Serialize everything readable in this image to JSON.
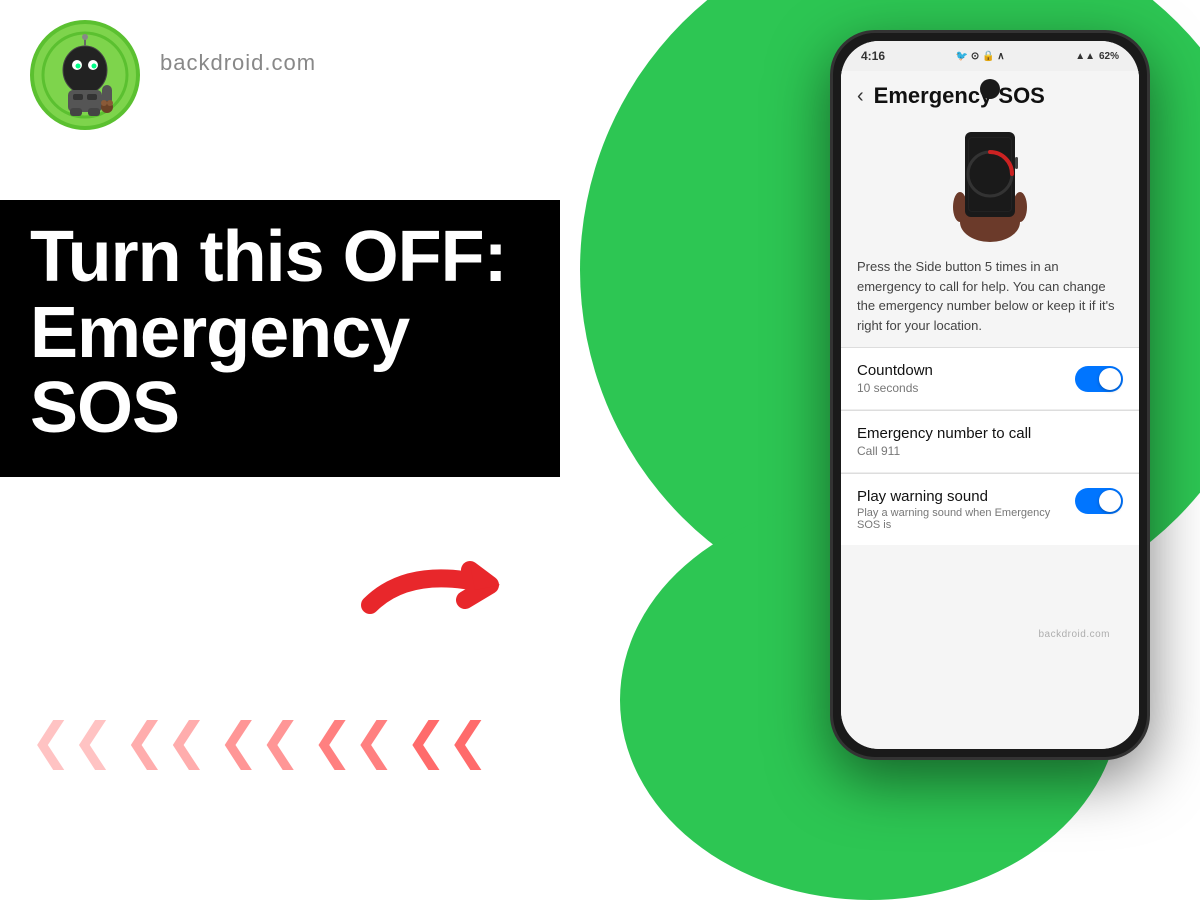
{
  "site": {
    "name": "backdroid.com"
  },
  "logo": {
    "alt": "Backdroid robot logo"
  },
  "main_text": {
    "line1": "Turn this OFF:",
    "line2": "Emergency",
    "line3": "SOS"
  },
  "phone": {
    "status_bar": {
      "time": "4:16",
      "battery": "62%",
      "signal": "▲▲▲",
      "icons": "🐦 ⊙ 🔒 ∧"
    },
    "screen_title": "Emergency SOS",
    "back_label": "‹",
    "description": "Press the Side button 5 times in an emergency to call for help. You can change the emergency number below or keep it if it's right for your location.",
    "settings": [
      {
        "label": "Countdown",
        "sublabel": "10 seconds",
        "has_toggle": true,
        "toggle_on": true
      },
      {
        "label": "Emergency number to call",
        "sublabel": "Call 911",
        "has_toggle": false
      },
      {
        "label": "Play warning sound",
        "sublabel": "Play a warning sound when Emergency SOS is",
        "has_toggle": true,
        "toggle_on": true
      }
    ]
  },
  "chevrons": [
    "❮❮",
    "❮❮",
    "❮❮",
    "❮❮",
    "❮❮"
  ],
  "arrow": {
    "color": "#e8272b"
  },
  "colors": {
    "green": "#2dc653",
    "black": "#000000",
    "white": "#ffffff",
    "toggle_on": "#0075ff",
    "red": "#e8272b"
  }
}
